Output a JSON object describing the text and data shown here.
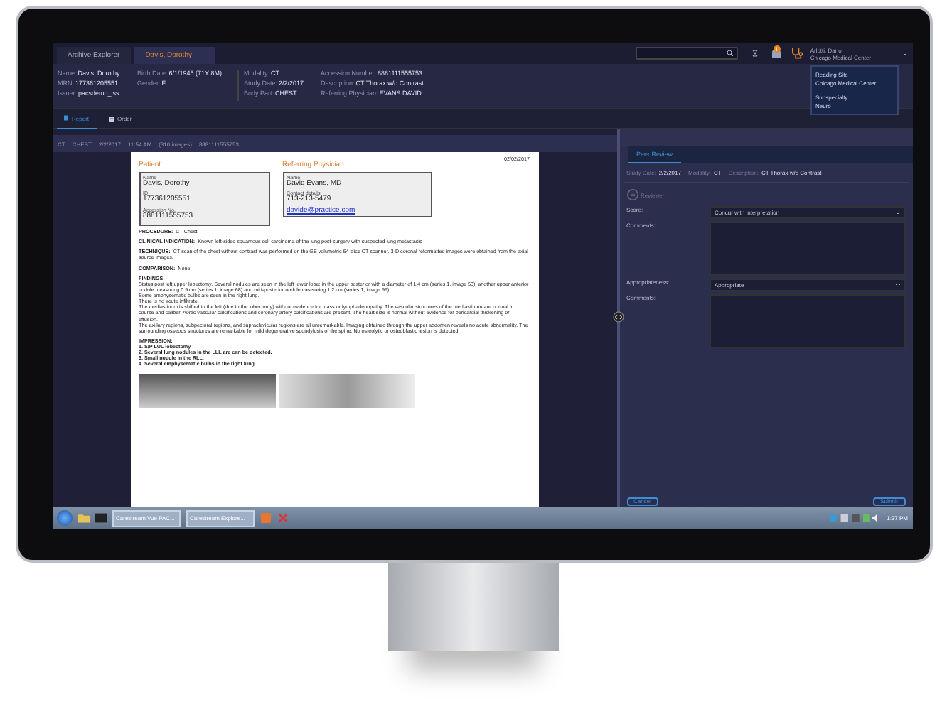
{
  "tabs": [
    {
      "label": "Archive Explorer",
      "selected": false
    },
    {
      "label": "Davis, Dorothy",
      "selected": true
    }
  ],
  "notification_badge": "!",
  "user": {
    "name": "Arlotti, Dario",
    "site": "Chicago Medical Center"
  },
  "patient_fields": [
    [
      {
        "label": "Name:",
        "value": "Davis, Dorothy"
      },
      {
        "label": "MRN:",
        "value": "177361205551"
      },
      {
        "label": "Issuer:",
        "value": "pacsdemo_iss"
      }
    ],
    [
      {
        "label": "Birth Date:",
        "value": "6/1/1945 (71Y 8M)"
      },
      {
        "label": "Gender:",
        "value": "F"
      }
    ],
    [
      {
        "label": "Modality:",
        "value": "CT"
      },
      {
        "label": "Study Date:",
        "value": "2/2/2017"
      },
      {
        "label": "Body Part:",
        "value": "CHEST"
      }
    ],
    [
      {
        "label": "Accession Number:",
        "value": "8881111555753"
      },
      {
        "label": "Description:",
        "value": "CT Thorax w/o Contrast"
      },
      {
        "label": "Referring Physician:",
        "value": "EVANS DAVID"
      }
    ]
  ],
  "view_tabs": [
    {
      "label": "Report",
      "selected": true,
      "kind": "report"
    },
    {
      "label": "Order",
      "selected": false,
      "kind": "order"
    }
  ],
  "site_popup": [
    {
      "label": "Reading Site",
      "value": "Chicago Medical Center"
    },
    {
      "label": "Subspecialty",
      "value": "Neuro"
    }
  ],
  "study_bar": [
    "CT",
    "CHEST",
    "2/2/2017",
    "11:54 AM",
    "(310 images)",
    "8881111555753"
  ],
  "report": {
    "date": "02/02/2017",
    "boxes": [
      {
        "heading": "Patient",
        "fields": [
          {
            "label": "Name",
            "value": "Davis, Dorothy"
          },
          {
            "label": "ID",
            "value": "177361205551"
          },
          {
            "label": "Accession No.",
            "value": "8881111555753"
          }
        ]
      },
      {
        "heading": "Referring Physician",
        "fields": [
          {
            "label": "Name",
            "value": "David Evans, MD"
          },
          {
            "label": "Contact details",
            "value": "713-213-5479"
          }
        ],
        "link": "davide@practice.com"
      }
    ],
    "sections": [
      {
        "label": "PROCEDURE:",
        "text": "CT Chest"
      },
      {
        "label": "CLINICAL INDICATION:",
        "text": "Known left-sided squamous cell carcinoma of the lung post-surgery with suspected lung metastasis"
      },
      {
        "label": "TECHNIQUE:",
        "text": "CT scan of the chest without contrast was performed on the GE volumetric 64 slice CT scanner.   3-D coronal reformatted images were obtained from the axial source images."
      },
      {
        "label": "COMPARISON:",
        "text": "None"
      }
    ],
    "findings_label": "FINDINGS:",
    "findings": [
      "Status post left upper lobectomy. Several nodules are seen in the left lower lobe: in the upper posterior with a diameter of 1.4 cm (series 1, image 53), another upper anterior nodule measuring 0.9 cm (series 1, image 68) and mid-posterior nodule measuring 1.2 cm (series 1, image 99).",
      "Some emphysematic bulbs are seen in the right lung.",
      "There is no acute infiltrate.",
      "The mediastinum is shifted to the left (due to the lobectomy) without evidence for mass or lymphadenopathy.  The vascular structures of the mediastinum are normal in course and caliber.  Aortic vascular calcifications and coronary artery calcifications are present. The heart size is normal without evidence for pericardial thickening or effusion.",
      "The axillary regions, subpectoral regions, and supraclavicular regions are all unremarkable.  Imaging obtained through the upper abdomen reveals no acute abnormality.  The surrounding osseous structures are remarkable for mild degenerative spondylosis of the spine.  No osteolytic or osteoblastic lesion is detected."
    ],
    "impression_label": "IMPRESSION:",
    "impression": [
      "1. S/P LUL lobectomy",
      "2. Several lung nodules in the LLL are can be detected.",
      "3. Small nodule in the RLL.",
      "4. Several emphysematic bulbs in the right lung"
    ]
  },
  "peer_review": {
    "tab": {
      "label": "Peer Review",
      "selected": true
    },
    "meta": [
      {
        "label": "Study Date:",
        "value": "2/2/2017"
      },
      {
        "label": "Modality:",
        "value": "CT"
      },
      {
        "label": "Description:",
        "value": "CT Thorax w/o Contrast"
      }
    ],
    "reviewer": "Reviewer",
    "rows": [
      {
        "label": "Score:",
        "value": "Concur with interpretation",
        "comments_label": "Comments:"
      },
      {
        "label": "Appropriateness:",
        "value": "Appropriate",
        "comments_label": "Comments:"
      }
    ],
    "buttons": [
      "Cancel",
      "Submit"
    ]
  },
  "taskbar": {
    "tasks": [
      "Carestream Vue PAC...",
      "Carestream Explore..."
    ],
    "clock": "1:37 PM"
  }
}
